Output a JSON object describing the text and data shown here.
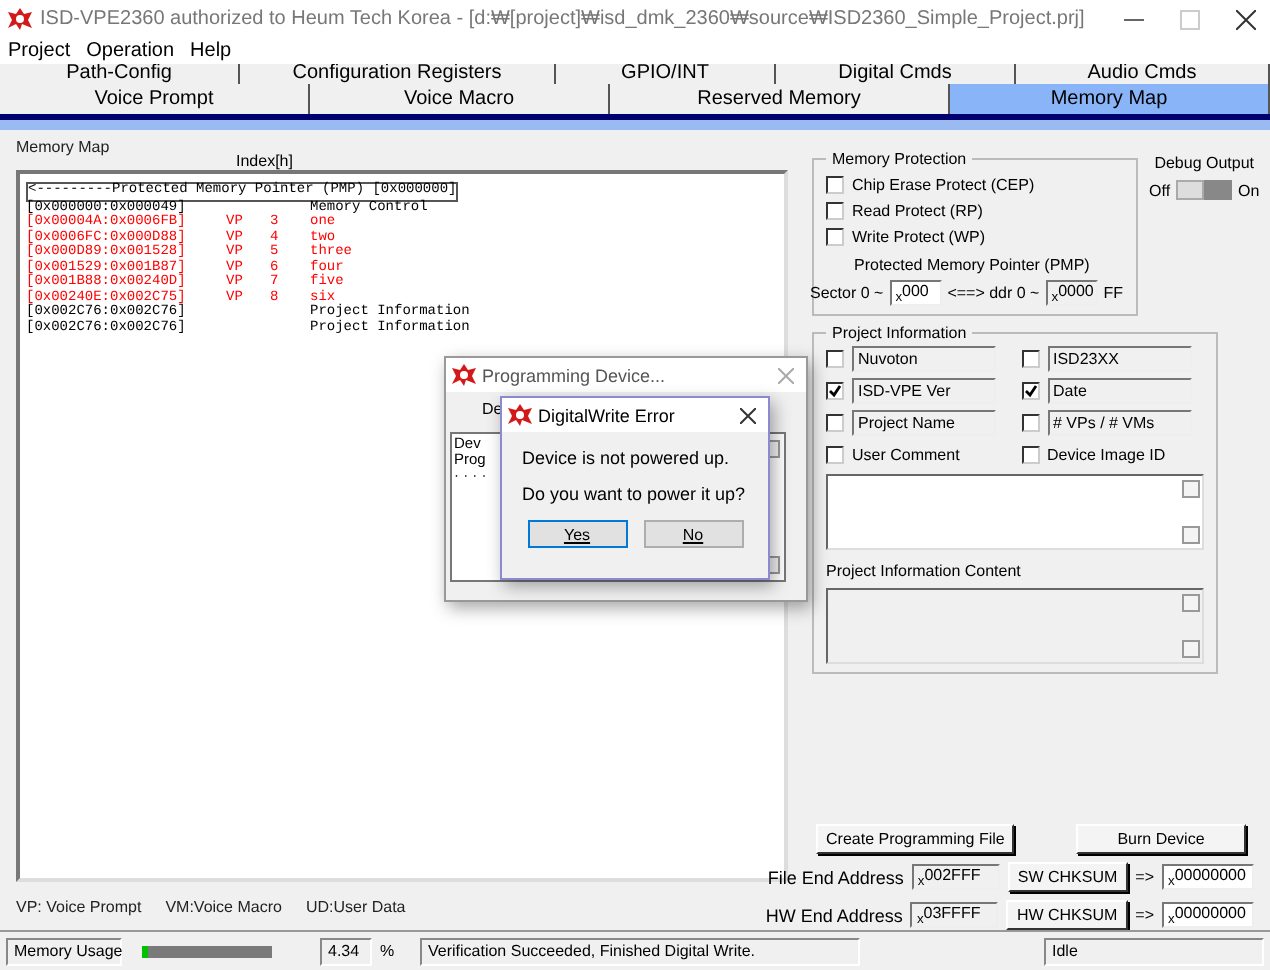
{
  "window": {
    "title": "ISD-VPE2360 authorized to Heum Tech Korea - [d:₩[project]₩isd_dmk_2360₩source₩ISD2360_Simple_Project.prj]"
  },
  "menu": [
    "Project",
    "Operation",
    "Help"
  ],
  "tabs_back": [
    {
      "label": "Path-Config",
      "selected": false
    },
    {
      "label": "Configuration Registers",
      "selected": false
    },
    {
      "label": "GPIO/INT",
      "selected": false
    },
    {
      "label": "Digital Cmds",
      "selected": false
    },
    {
      "label": "Audio Cmds",
      "selected": false
    }
  ],
  "tabs": [
    {
      "label": "Voice Prompt",
      "selected": false
    },
    {
      "label": "Voice Macro",
      "selected": false
    },
    {
      "label": "Reserved Memory",
      "selected": false
    },
    {
      "label": "Memory Map",
      "selected": true
    }
  ],
  "memory_map": {
    "label": "Memory Map",
    "index_label": "Index[h]",
    "header": "<---------Protected Memory Pointer (PMP) [0x000000]",
    "rows": [
      {
        "range": "[0x000000:0x000049]",
        "type": "",
        "index": "",
        "name": "Memory Control",
        "color": "#000000"
      },
      {
        "range": "[0x00004A:0x0006FB]",
        "type": "VP",
        "index": "3",
        "name": "one",
        "color": "#ff0000"
      },
      {
        "range": "[0x0006FC:0x000D88]",
        "type": "VP",
        "index": "4",
        "name": "two",
        "color": "#ff0000"
      },
      {
        "range": "[0x000D89:0x001528]",
        "type": "VP",
        "index": "5",
        "name": "three",
        "color": "#ff0000"
      },
      {
        "range": "[0x001529:0x001B87]",
        "type": "VP",
        "index": "6",
        "name": "four",
        "color": "#ff0000"
      },
      {
        "range": "[0x001B88:0x00240D]",
        "type": "VP",
        "index": "7",
        "name": "five",
        "color": "#ff0000"
      },
      {
        "range": "[0x00240E:0x002C75]",
        "type": "VP",
        "index": "8",
        "name": "six",
        "color": "#ff0000"
      },
      {
        "range": "[0x002C76:0x002C76]",
        "type": "",
        "index": "",
        "name": "Project Information",
        "color": "#000000"
      },
      {
        "range": "[0x002C76:0x002C76]",
        "type": "",
        "index": "",
        "name": "Project Information",
        "color": "#000000"
      }
    ],
    "legend": [
      "VP: Voice Prompt",
      "VM:Voice Macro",
      "UD:User Data"
    ]
  },
  "memory_protection": {
    "title": "Memory Protection",
    "options": [
      {
        "label": "Chip Erase Protect (CEP)",
        "checked": false
      },
      {
        "label": "Read Protect (RP)",
        "checked": false
      },
      {
        "label": "Write Protect (WP)",
        "checked": false
      }
    ],
    "pmp_label": "Protected Memory Pointer (PMP)",
    "sector_label": "Sector 0 ~",
    "sector_value": "$_{x}$000",
    "arrow": "<==> ddr 0 ~",
    "addr_value": "$_{x}$0000",
    "addr_suffix": "FF"
  },
  "debug_output": {
    "label": "Debug Output",
    "off": "Off",
    "on_label": "On",
    "on": false
  },
  "project_information": {
    "title": "Project Information",
    "items": [
      {
        "kind": "field",
        "value": "Nuvoton",
        "checked": false
      },
      {
        "kind": "field",
        "value": "ISD23XX",
        "checked": false
      },
      {
        "kind": "field",
        "value": "ISD-VPE Ver",
        "checked": true
      },
      {
        "kind": "field",
        "value": "Date",
        "checked": true
      },
      {
        "kind": "field",
        "value": "Project Name",
        "checked": false
      },
      {
        "kind": "field",
        "value": "# VPs / # VMs",
        "checked": false
      },
      {
        "kind": "label",
        "value": "User Comment",
        "checked": false
      },
      {
        "kind": "label",
        "value": "Device Image ID",
        "checked": false
      }
    ],
    "content_label": "Project Information Content"
  },
  "buttons": [
    "Create Programming File",
    "Burn Device"
  ],
  "addresses": [
    {
      "label": "File End Address",
      "value": "$_{x}$002FFF",
      "button": "SW CHKSUM",
      "arrow": "=>",
      "result": "$_{x}$00000000"
    },
    {
      "label": "HW End Address",
      "value": "$_{x}$03FFFF",
      "button": "HW CHKSUM",
      "arrow": "=>",
      "result": "$_{x}$00000000"
    }
  ],
  "status_bar": {
    "label": "Memory Usage",
    "level": 0.0434,
    "percent": "4.34",
    "unit": "%",
    "message": "Verification Succeeded, Finished Digital Write.",
    "state": "Idle"
  },
  "programming_dialog": {
    "title": "Programming Device...",
    "label": "De",
    "log": [
      "Dev",
      "Prog",
      "· · · ·"
    ]
  },
  "error_dialog": {
    "title": "DigitalWrite Error",
    "lines": [
      "Device is not powered up.",
      "Do you want to power it up?"
    ],
    "buttons": [
      {
        "label": "Yes",
        "selected": true
      },
      {
        "label": "No",
        "selected": false
      }
    ]
  }
}
